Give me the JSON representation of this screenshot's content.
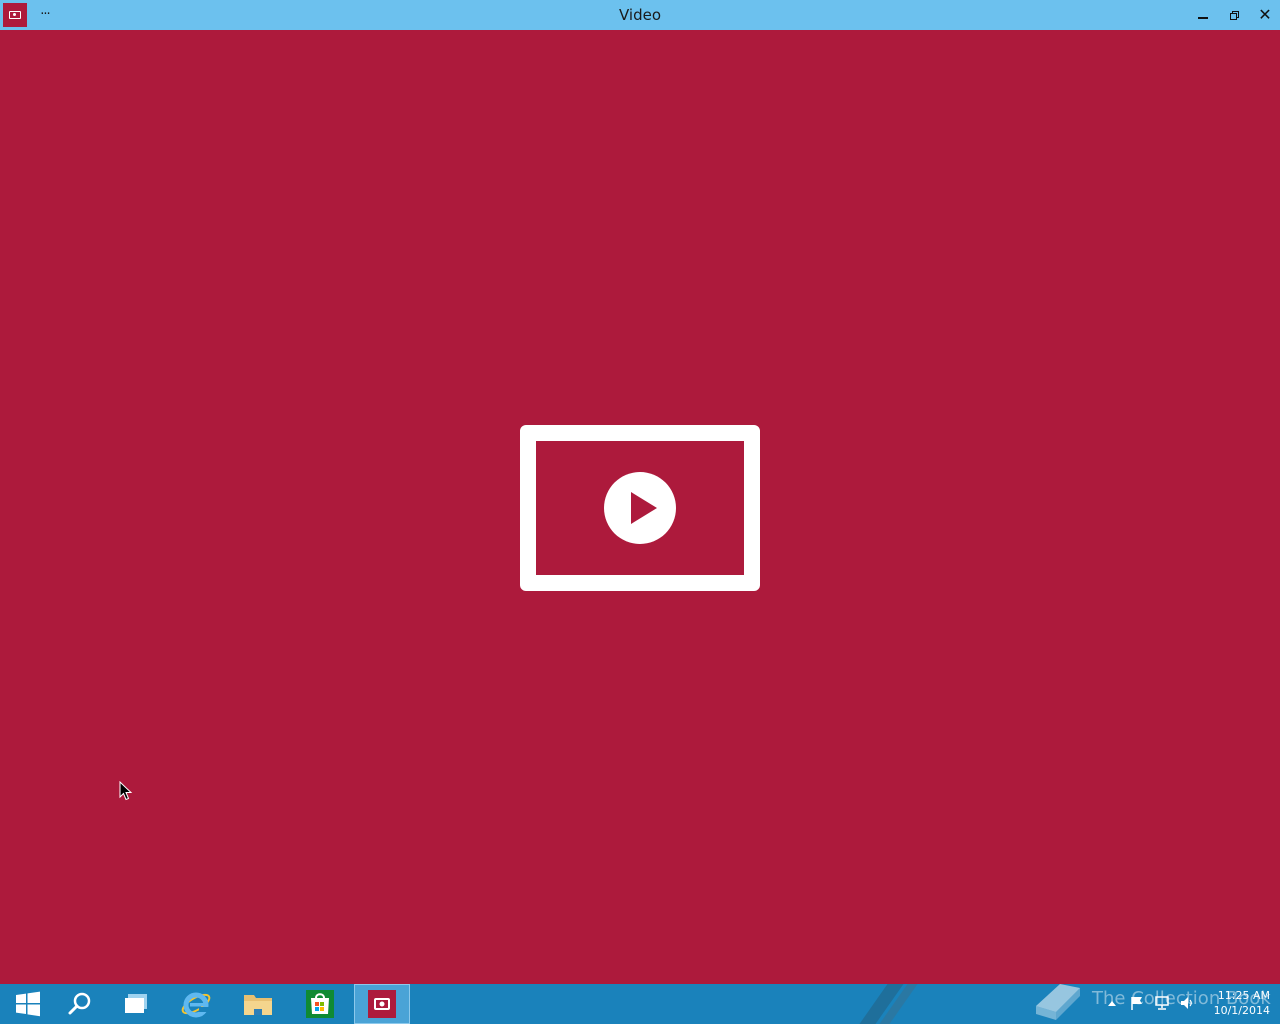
{
  "window": {
    "title": "Video",
    "more_label": "···"
  },
  "colors": {
    "title_bar": "#6cc1ee",
    "app_background": "#ad1a3c",
    "taskbar": "#1a82bb",
    "placeholder_icon": "#ffffff"
  },
  "content": {
    "placeholder_icon": "video-play-icon"
  },
  "taskbar": {
    "items": [
      {
        "name": "start-button",
        "icon": "windows-logo-icon"
      },
      {
        "name": "search-button",
        "icon": "search-icon"
      },
      {
        "name": "task-view-button",
        "icon": "task-view-icon"
      },
      {
        "name": "internet-explorer-button",
        "icon": "internet-explorer-icon"
      },
      {
        "name": "file-explorer-button",
        "icon": "folder-icon"
      },
      {
        "name": "store-button",
        "icon": "store-icon"
      },
      {
        "name": "video-app-button",
        "icon": "video-app-icon",
        "active": true
      }
    ],
    "watermark": "The Collection Book",
    "clock": {
      "time": "11:25 AM",
      "date": "10/1/2014"
    }
  }
}
